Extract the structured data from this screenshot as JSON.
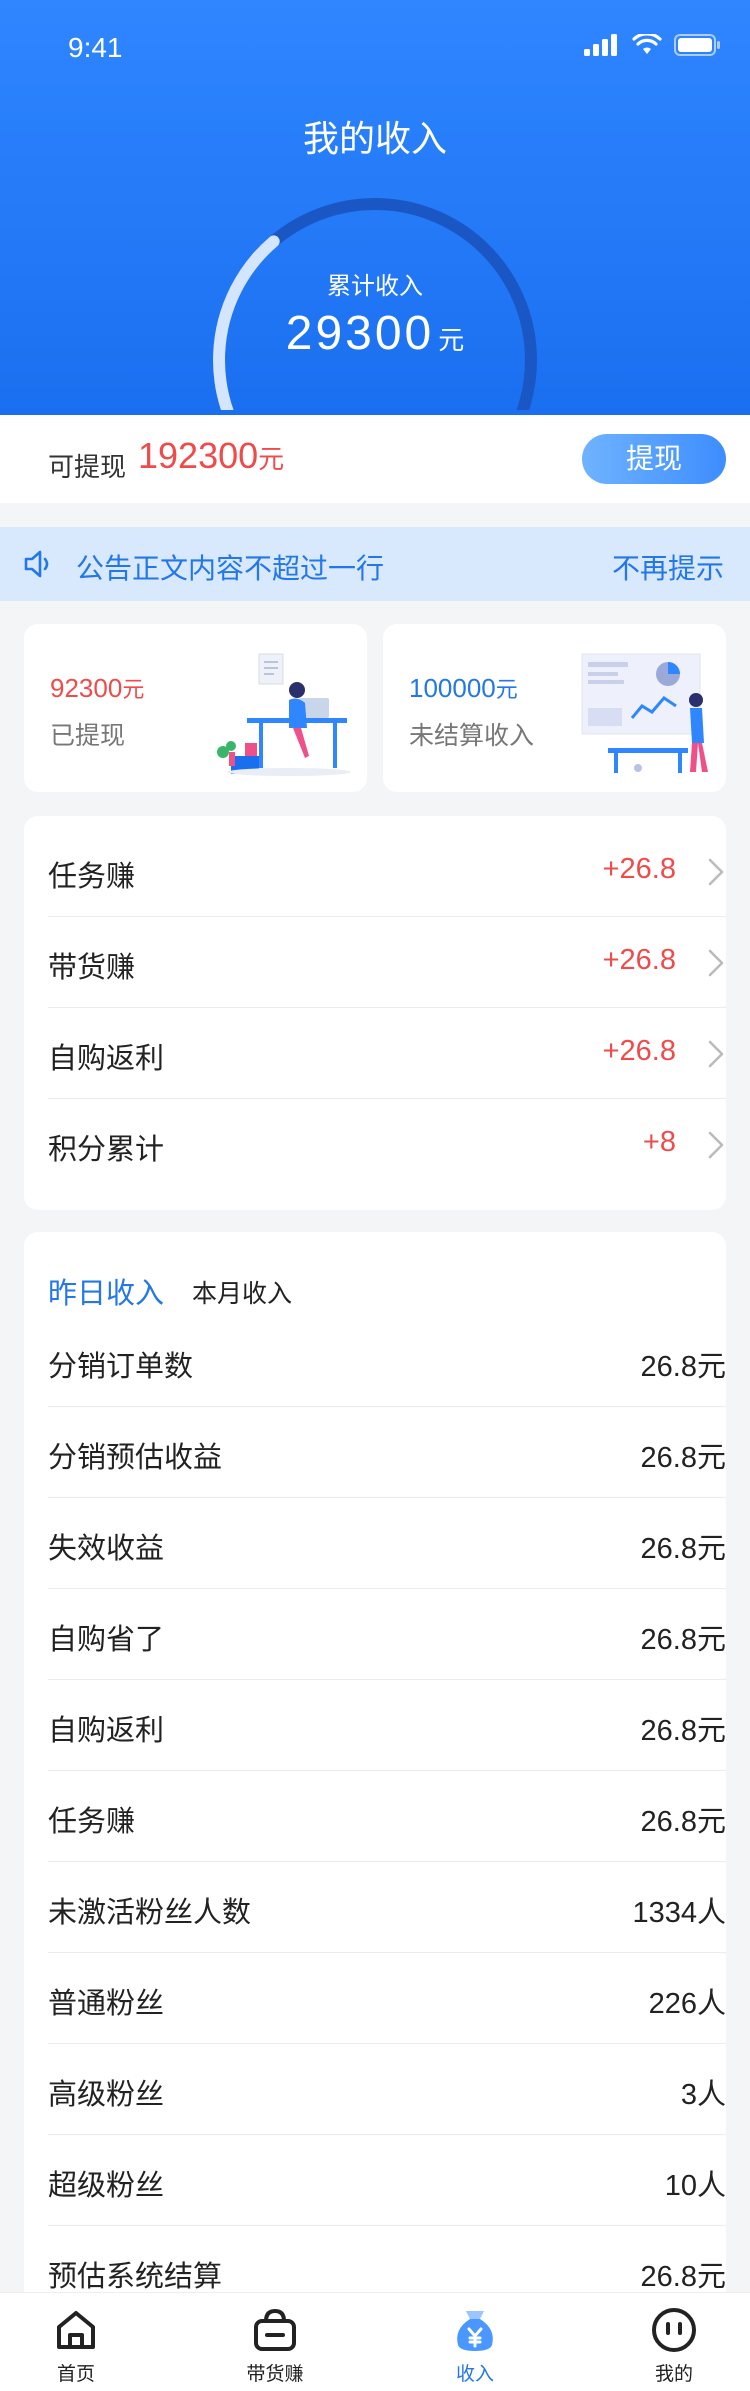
{
  "status": {
    "time": "9:41"
  },
  "header": {
    "title": "我的收入",
    "total_label": "累计收入",
    "total_value": "29300",
    "total_unit": "元",
    "gauge_fraction": 0.35
  },
  "withdraw": {
    "label": "可提现",
    "amount": "192300",
    "unit": "元",
    "button": "提现"
  },
  "notice": {
    "text": "公告正文内容不超过一行",
    "dismiss": "不再提示"
  },
  "cards": [
    {
      "value": "92300",
      "unit": "元",
      "caption": "已提现",
      "color": "#f04b4b"
    },
    {
      "value": "100000",
      "unit": "元",
      "caption": "未结算收入",
      "color": "#2377e8"
    }
  ],
  "earnings": [
    {
      "label": "任务赚",
      "value": "+26.8"
    },
    {
      "label": "带货赚",
      "value": "+26.8"
    },
    {
      "label": "自购返利",
      "value": "+26.8"
    },
    {
      "label": "积分累计",
      "value": "+8"
    }
  ],
  "detail": {
    "tab_active": "昨日收入",
    "tab_inactive": "本月收入",
    "rows": [
      {
        "label": "分销订单数",
        "value": "26.8元"
      },
      {
        "label": "分销预估收益",
        "value": "26.8元"
      },
      {
        "label": "失效收益",
        "value": "26.8元"
      },
      {
        "label": "自购省了",
        "value": "26.8元"
      },
      {
        "label": "自购返利",
        "value": "26.8元"
      },
      {
        "label": "任务赚",
        "value": "26.8元"
      },
      {
        "label": "未激活粉丝人数",
        "value": "1334人"
      },
      {
        "label": "普通粉丝",
        "value": "226人"
      },
      {
        "label": "高级粉丝",
        "value": "3人"
      },
      {
        "label": "超级粉丝",
        "value": "10人"
      },
      {
        "label": "预估系统结算",
        "value": "26.8元"
      }
    ]
  },
  "tabbar": [
    {
      "label": "首页",
      "icon": "home-icon"
    },
    {
      "label": "带货赚",
      "icon": "bag-icon"
    },
    {
      "label": "收入",
      "icon": "money-bag-icon"
    },
    {
      "label": "我的",
      "icon": "profile-icon"
    }
  ],
  "colors": {
    "brand": "#2377e8",
    "red": "#f04b4b"
  }
}
